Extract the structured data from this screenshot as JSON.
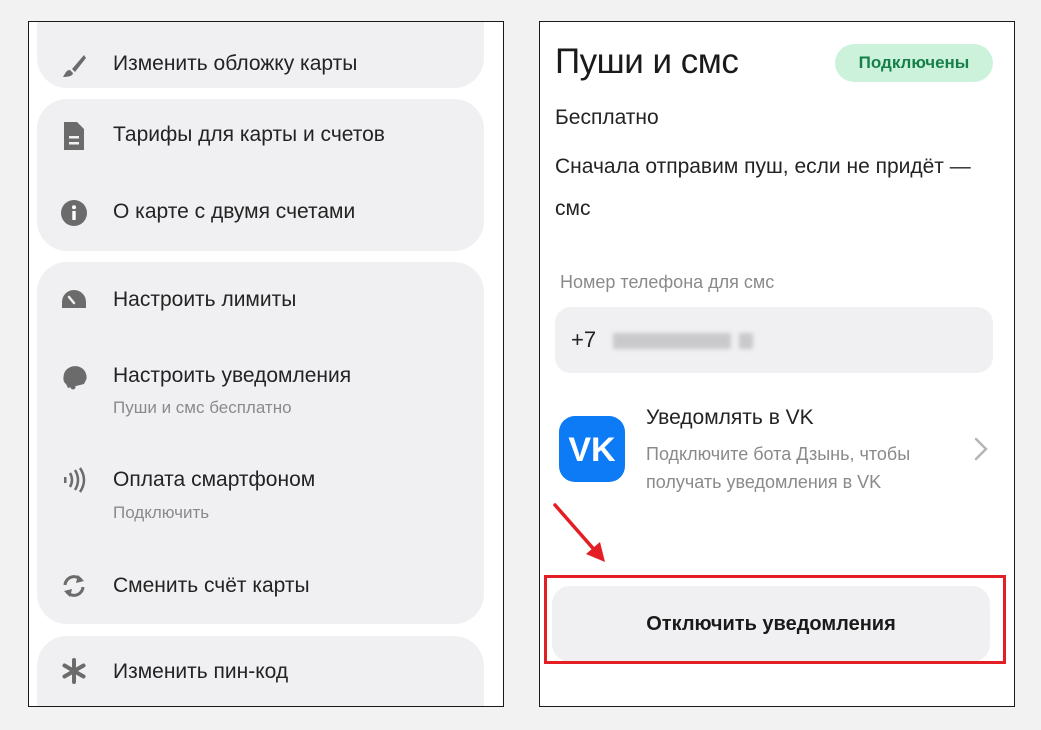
{
  "left_menu": {
    "card_cover": "Изменить обложку карты",
    "tariffs": "Тарифы для карты и счетов",
    "two_accounts": "О карте с двумя счетами",
    "limits": "Настроить лимиты",
    "notifications": "Настроить уведомления",
    "notifications_sub": "Пуши и смс бесплатно",
    "smartphone_pay": "Оплата смартфоном",
    "smartphone_pay_sub": "Подключить",
    "change_account": "Сменить счёт карты",
    "change_pin": "Изменить пин-код"
  },
  "notifications_screen": {
    "title": "Пуши и смс",
    "status_badge": "Подключены",
    "price": "Бесплатно",
    "description": "Сначала отправим пуш, если не придёт — смс",
    "phone_label": "Номер телефона для смс",
    "phone_prefix": "+7",
    "vk_logo_text": "VK",
    "vk_title": "Уведомлять в VK",
    "vk_subtitle": "Подключите бота Дзынь, чтобы получать уведомления в VK",
    "disable_button": "Отключить уведомления"
  },
  "colors": {
    "accent_red": "#e31e24",
    "badge_bg": "#cdf2dc",
    "badge_text": "#17804a",
    "vk_blue": "#0d7bf5"
  }
}
